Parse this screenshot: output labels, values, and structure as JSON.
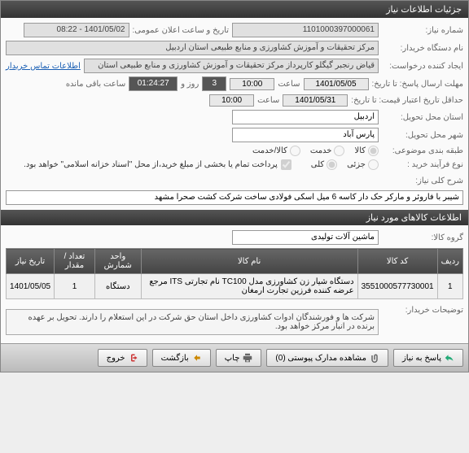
{
  "titlebar": "جزئیات اطلاعات نیاز",
  "fields": {
    "need_no_label": "شماره نیاز:",
    "need_no": "1101000397000061",
    "announce_label": "تاریخ و ساعت اعلان عمومی:",
    "announce_value": "1401/05/02 - 08:22",
    "buyer_org_label": "نام دستگاه خریدار:",
    "buyer_org": "مرکز تحقیقات و آموزش کشاورزی و منابع طبیعی استان اردبیل",
    "requester_label": "ایجاد کننده درخواست:",
    "requester": "قیاض رنجبر گیگلو کارپرداز مرکز تحقیقات و آموزش کشاورزی و منابع طبیعی استان",
    "contact_link": "اطلاعات تماس خریدار",
    "deadline_label": "مهلت ارسال پاسخ: تا تاریخ:",
    "deadline_date": "1401/05/05",
    "deadline_time_label": "ساعت",
    "deadline_time": "10:00",
    "remaining_days": "3",
    "remaining_days_label": "روز و",
    "remaining_time": "01:24:27",
    "remaining_label": "ساعت باقی مانده",
    "validity_label": "حداقل تاریخ اعتبار قیمت: تا تاریخ:",
    "validity_date": "1401/05/31",
    "validity_time_label": "ساعت",
    "validity_time": "10:00",
    "delivery_province_label": "استان محل تحویل:",
    "delivery_province": "اردبیل",
    "delivery_city_label": "شهر محل تحویل:",
    "delivery_city": "پارس آباد",
    "supply_class_label": "طبقه بندی موضوعی:",
    "purchase_type_label": "نوع فرآیند خرید :",
    "payment_note": "پرداخت تمام یا بخشی از مبلغ خرید،از محل \"اسناد خزانه اسلامی\" خواهد بود."
  },
  "radios": {
    "goods": "کالا",
    "service": "خدمت",
    "both": "کالا/خدمت",
    "partial": "جزئی",
    "total": "کلی"
  },
  "need_title_label": "شرح کلی نیاز:",
  "need_title": "شیبر با فاروئر و مارکر حک دار کاسه 6 میل اسکی فولادی ساخت شرکت کشت صحرا مشهد",
  "items_section": "اطلاعات کالاهای مورد نیاز",
  "group_label": "گروه کالا:",
  "group_value": "ماشین آلات تولیدی",
  "table": {
    "headers": {
      "row": "ردیف",
      "code": "کد کالا",
      "name": "نام کالا",
      "unit": "واحد شمارش",
      "qty": "تعداد / مقدار",
      "date": "تاریخ نیاز"
    },
    "rows": [
      {
        "row": "1",
        "code": "3551000577730001",
        "name": "دستگاه شیار زن کشاورزی مدل TC100 نام تجارتی ITS مرجع عرضه کننده فرزین تجارت ارمغان",
        "unit": "دستگاه",
        "qty": "1",
        "date": "1401/05/05"
      }
    ]
  },
  "buyer_notes_label": "توضیحات خریدار:",
  "buyer_notes": "شرکت ها و فورشندگان ادوات کشاورزی داخل استان حق شرکت در این استعلام را دارند. تحویل بر عهده برنده در انبار مرکز خواهد بود.",
  "footer": {
    "back": "پاسخ به نیاز",
    "attachments": "مشاهده مدارک پیوستی (0)",
    "print": "چاپ",
    "return": "بازگشت",
    "exit": "خروج"
  }
}
